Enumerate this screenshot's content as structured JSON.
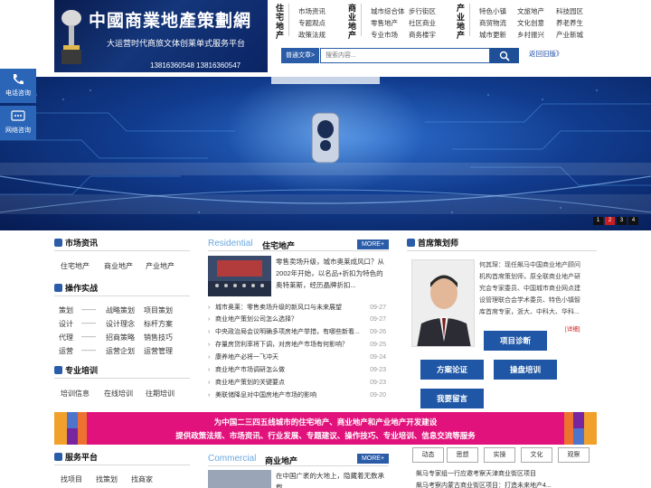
{
  "header": {
    "logo_title": "中國商業地產策劃網",
    "logo_slogan": "大运营时代商旅文体创莱单式服务平台",
    "logo_phones": "13816360548  13816360547",
    "nav": [
      {
        "title": "住宅地产",
        "col1": [
          "市场资讯",
          "专题观点",
          "政策法规"
        ]
      },
      {
        "title": "商业地产",
        "col1": [
          "城市综合体",
          "零售地产",
          "专业市场"
        ],
        "col2": [
          "步行街区",
          "社区商业",
          "商务楼宇"
        ]
      },
      {
        "title": "产业地产",
        "col1": [
          "特色小镇",
          "商贸物流",
          "城市更新"
        ],
        "col2": [
          "文旅地产",
          "文化创意",
          "乡村振兴"
        ],
        "col3": [
          "科技园区",
          "养老养生",
          "产业新城"
        ]
      }
    ],
    "search": {
      "label": "普通文章>",
      "placeholder": "搜索内容...",
      "back_link": "返回旧版》"
    }
  },
  "consult": [
    {
      "label": "电话咨询"
    },
    {
      "label": "网络咨询"
    }
  ],
  "banner": {
    "slides": [
      "1",
      "2",
      "3",
      "4"
    ],
    "active_slide": "2"
  },
  "left": {
    "market": {
      "title": "市场资讯",
      "links": [
        "住宅地产",
        "商业地产",
        "产业地产"
      ]
    },
    "practice": {
      "title": "操作实战",
      "rows": [
        {
          "cat": "策划",
          "sep": "——",
          "a": "战略策划",
          "b": "项目策划"
        },
        {
          "cat": "设计",
          "sep": "——",
          "a": "设计理念",
          "b": "标杆方案"
        },
        {
          "cat": "代理",
          "sep": "——",
          "a": "招商策略",
          "b": "销售技巧"
        },
        {
          "cat": "运营",
          "sep": "——",
          "a": "运营企划",
          "b": "运营管理"
        }
      ]
    },
    "training": {
      "title": "专业培训",
      "links": [
        "培训信息",
        "在线培训",
        "往期培训"
      ]
    },
    "service": {
      "title": "服务平台",
      "links": [
        "找项目",
        "找策划",
        "找商家"
      ]
    }
  },
  "middle": {
    "residential": {
      "tag_en": "Residential",
      "tag_cn": "住宅地产",
      "more": "MORE+",
      "feature_text": "零售卖场升级，城市奥莱成风口？从2002年开始，以名品+折扣为特色的奥特莱斯，经历晶牌折扣...",
      "items": [
        {
          "title": "城市奥莱：零售卖场升级的新风口与未来展望",
          "date": "09-27"
        },
        {
          "title": "商业地产策划公司怎么选择？",
          "date": "09-27"
        },
        {
          "title": "中央政治局会议明确多项房地产举措，有哪些新看...",
          "date": "09-26"
        },
        {
          "title": "存量房贷利率将下调，对房地产市场有何影响？",
          "date": "09-25"
        },
        {
          "title": "康养地产必将一飞冲天",
          "date": "09-24"
        },
        {
          "title": "商业地产市场调研怎么做",
          "date": "09-23"
        },
        {
          "title": "商业地产策划的关键要点",
          "date": "09-23"
        },
        {
          "title": "美联储降息对中国房地产市场的影响",
          "date": "09-20"
        }
      ]
    },
    "commercial": {
      "tag_en": "Commercial",
      "tag_cn": "商业地产",
      "more": "MORE+",
      "feature_text": "在中国广袤的大地上，隐藏着无数承载"
    }
  },
  "right": {
    "title": "首席策划师",
    "bio": "何其琛：现任飙马中国商业地产顾问机构首席策划师，原全联商业地产研究会专家委员、中国城市商业网点建设管理联合会学术委员、特色小镇智库首席专家，浙大、中科大、华科...",
    "detail": "[详细]",
    "buttons": [
      "项目诊断",
      "方案论证",
      "操盘培训",
      "我要留言"
    ]
  },
  "strip": {
    "line1": "为中国二三四五线城市的住宅地产、商业地产和产业地产开发建设",
    "line2": "提供政策法规、市场资讯、行业发展、专题建议、操作技巧、专业培训、信息交流等服务"
  },
  "bottom": {
    "tags": [
      "动态",
      "思想",
      "实操",
      "文化",
      "观察"
    ],
    "news": [
      "飙马专家组一行应邀考察天津商业街区项目",
      "飙马考察内蒙古商业街区项目：打造未来地产4..."
    ]
  },
  "colors": {
    "brand_blue": "#2a5ca8",
    "strip_pink": "#e1127c",
    "active_dot": "#c81d1d"
  }
}
